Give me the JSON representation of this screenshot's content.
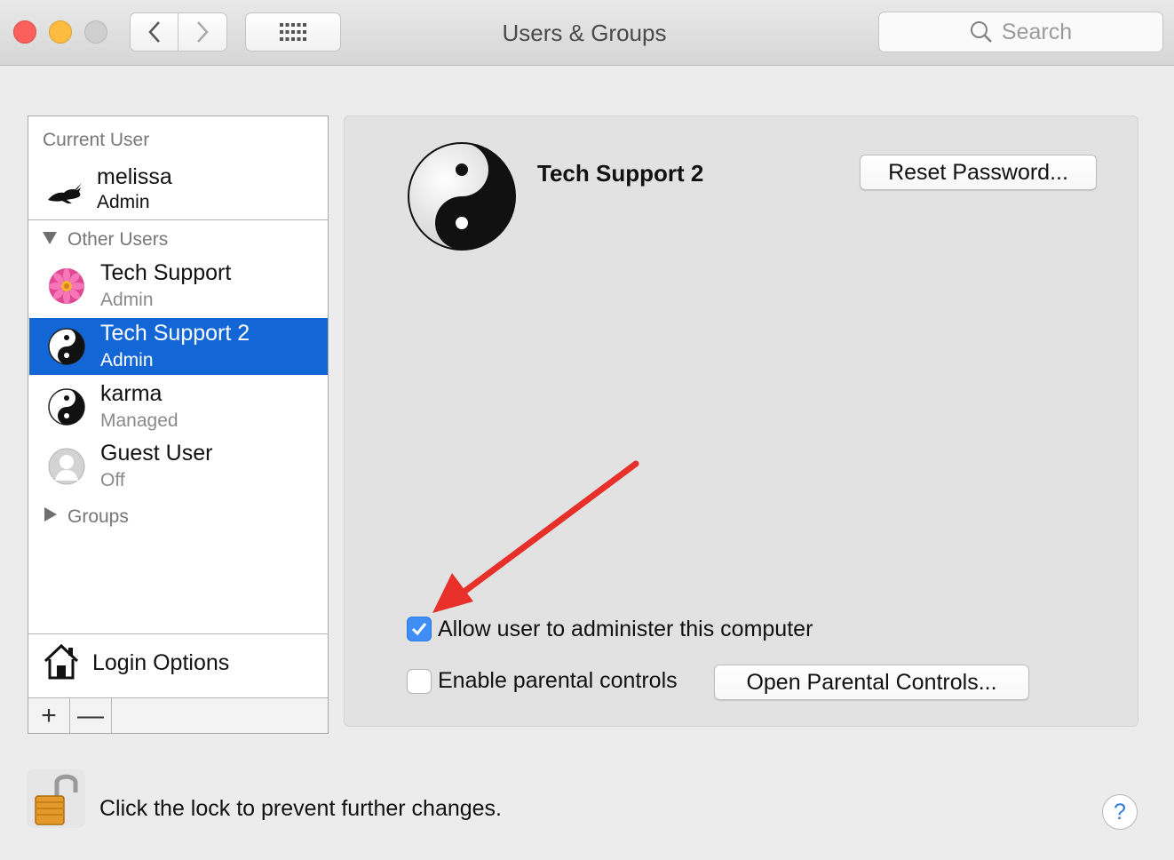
{
  "window": {
    "title": "Users & Groups"
  },
  "toolbar": {
    "back_icon": "chevron-left-icon",
    "forward_icon": "chevron-right-icon",
    "show_all_icon": "grid-icon",
    "search_placeholder": "Search"
  },
  "sidebar": {
    "current_user_label": "Current User",
    "current_user": {
      "name": "melissa",
      "role": "Admin",
      "avatar": "rabbit-icon"
    },
    "other_users_label": "Other Users",
    "other_users": [
      {
        "name": "Tech Support",
        "role": "Admin",
        "avatar": "flower-icon"
      },
      {
        "name": "Tech Support 2",
        "role": "Admin",
        "avatar": "yin-yang-icon"
      },
      {
        "name": "karma",
        "role": "Managed",
        "avatar": "yin-yang-icon"
      },
      {
        "name": "Guest User",
        "role": "Off",
        "avatar": "guest-silhouette-icon"
      }
    ],
    "selected_index": 1,
    "groups_label": "Groups",
    "login_options_label": "Login Options",
    "add_symbol": "+",
    "remove_symbol": "—"
  },
  "detail": {
    "user_name": "Tech Support 2",
    "reset_password_label": "Reset Password...",
    "allow_admin_label": "Allow user to administer this computer",
    "allow_admin_checked": true,
    "parental_controls_label": "Enable parental controls",
    "parental_controls_checked": false,
    "open_parental_controls_label": "Open Parental Controls..."
  },
  "footer": {
    "lock_text": "Click the lock to prevent further changes.",
    "help_symbol": "?"
  },
  "colors": {
    "selection": "#1266d6",
    "checkbox_on": "#3f8ef5",
    "annotation_arrow": "#e8302a"
  }
}
